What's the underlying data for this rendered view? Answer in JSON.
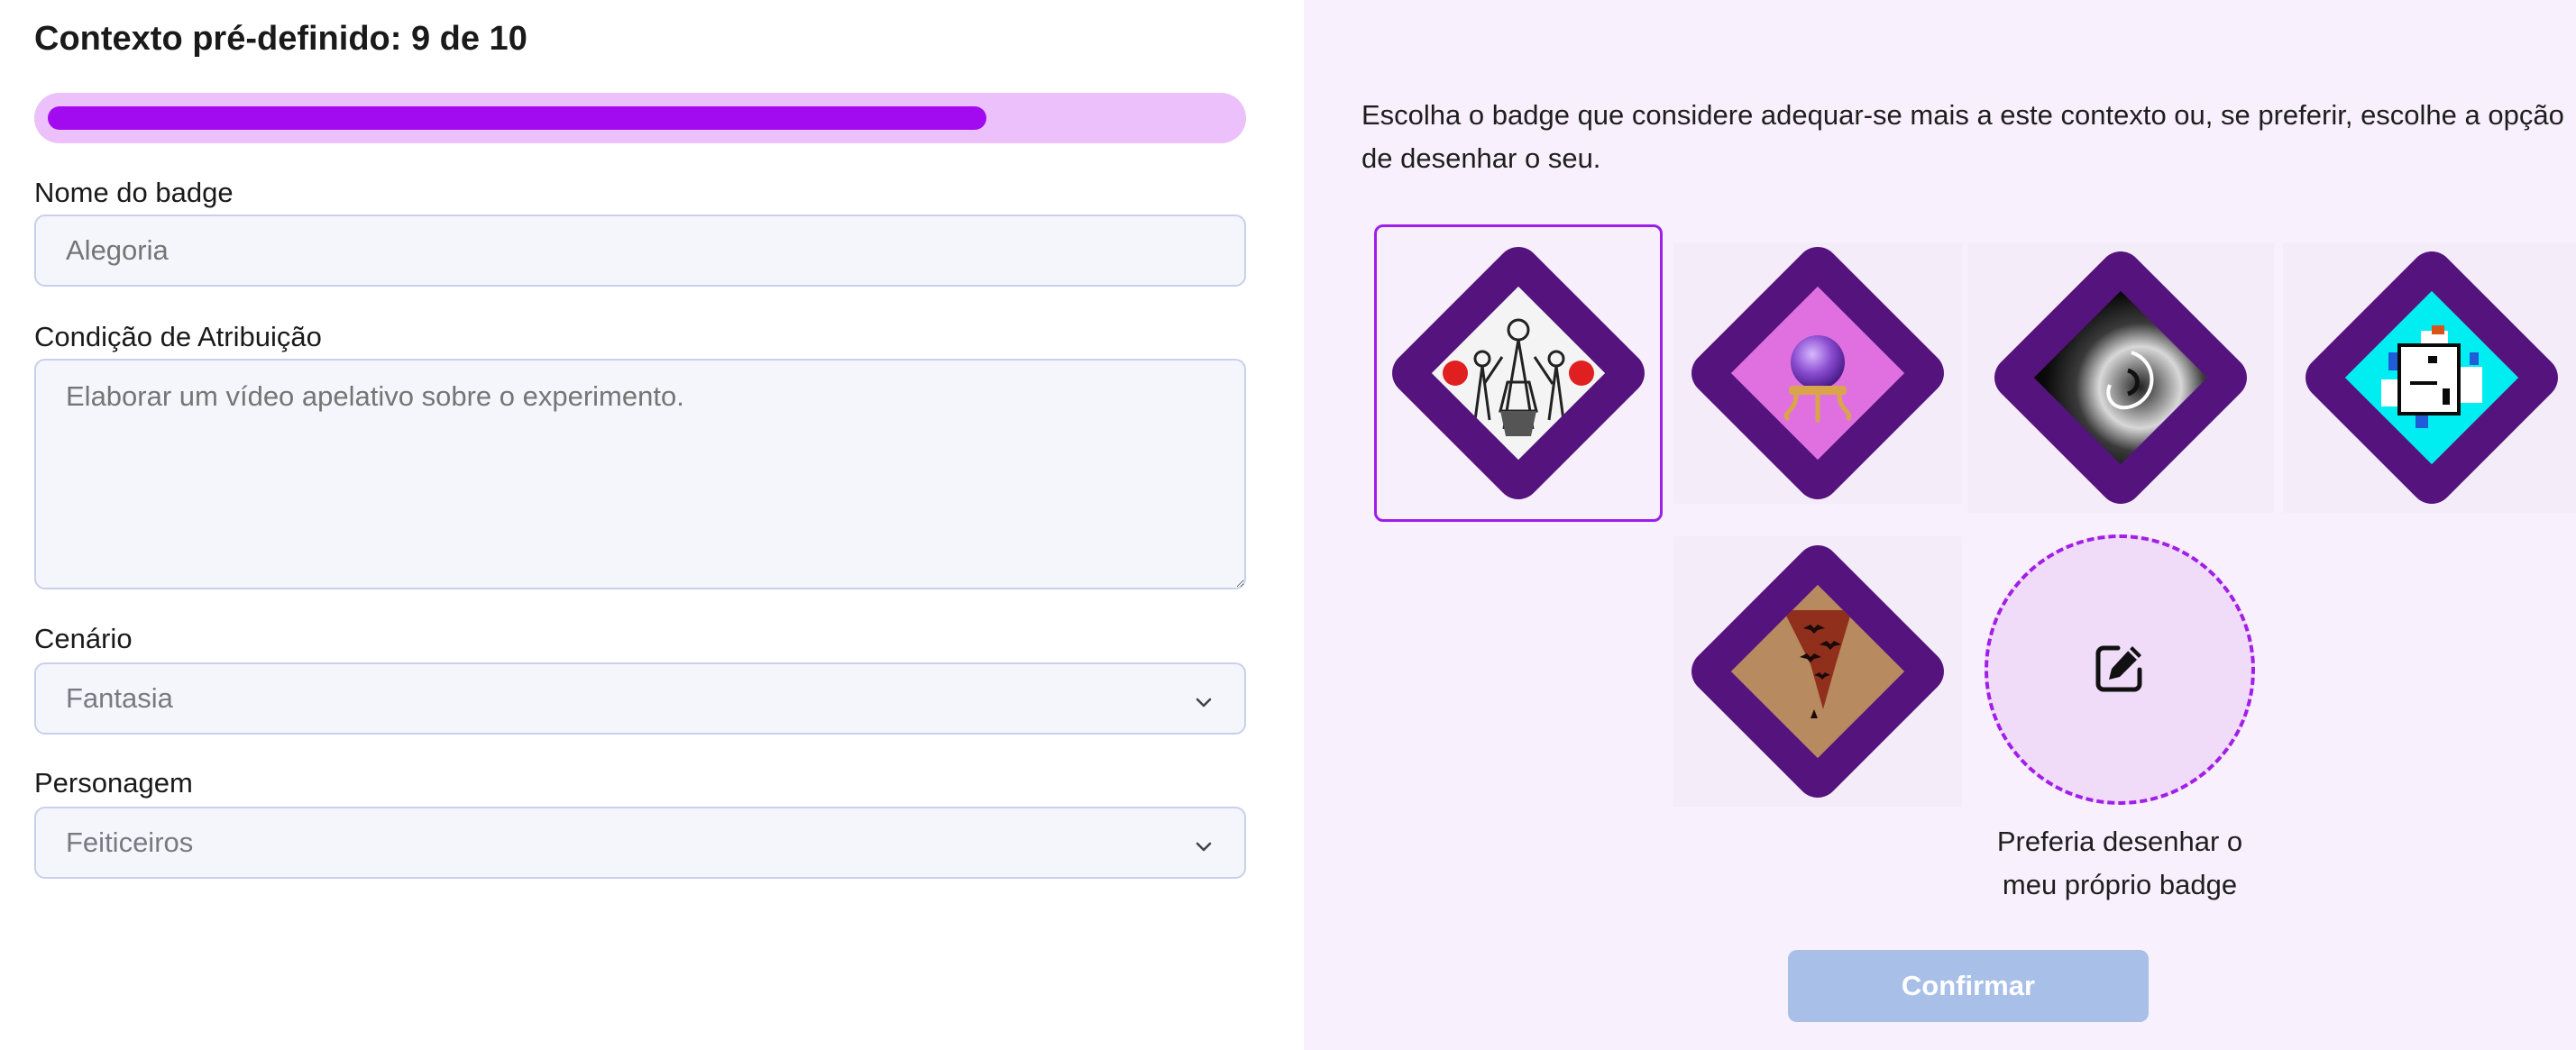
{
  "header": {
    "title": "Contexto pré-definido: 9 de 10"
  },
  "progress": {
    "value": 0.9,
    "color": "#a20af0",
    "track_color": "#ecc0fb"
  },
  "form": {
    "badge_name": {
      "label": "Nome do badge",
      "placeholder": "Alegoria"
    },
    "condition": {
      "label": "Condição de Atribuição",
      "placeholder": "Elaborar um vídeo apelativo sobre o experimento."
    },
    "scenario": {
      "label": "Cenário",
      "value": "Fantasia"
    },
    "character": {
      "label": "Personagem",
      "value": "Feiticeiros"
    }
  },
  "badges": {
    "instructions": "Escolha o badge que considere adequar-se mais a este contexto ou, se preferir, escolhe a opção de desenhar o seu.",
    "items": [
      {
        "name": "badge-allegory-figures",
        "selected": true,
        "bg": "#ffffff"
      },
      {
        "name": "badge-crystal-ball",
        "selected": false,
        "bg": "#e070e0"
      },
      {
        "name": "badge-dark-swirl",
        "selected": false,
        "bg": "#1a1a1a"
      },
      {
        "name": "badge-pixel-creature",
        "selected": false,
        "bg": "#00f0f0"
      },
      {
        "name": "badge-bats-landscape",
        "selected": false,
        "bg": "#b88a60"
      }
    ],
    "draw_option": {
      "caption": "Preferia desenhar o meu próprio badge",
      "icon": "edit-icon"
    }
  },
  "actions": {
    "confirm_label": "Confirmar"
  }
}
